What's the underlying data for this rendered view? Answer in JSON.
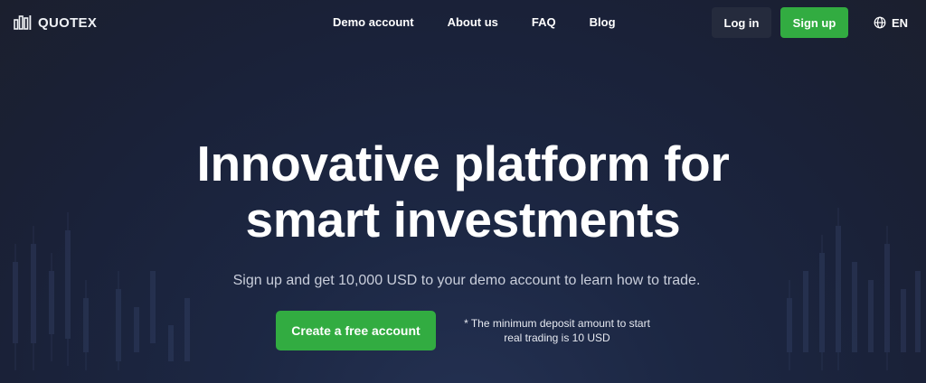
{
  "brand": {
    "name": "QUOTEX",
    "logo_icon": "quotex-bars-logo"
  },
  "nav": {
    "items": [
      {
        "label": "Demo account"
      },
      {
        "label": "About us"
      },
      {
        "label": "FAQ"
      },
      {
        "label": "Blog"
      }
    ]
  },
  "auth": {
    "login_label": "Log in",
    "signup_label": "Sign up"
  },
  "language": {
    "icon": "globe-icon",
    "label": "EN"
  },
  "hero": {
    "title_line1": "Innovative platform for",
    "title_line2": "smart investments",
    "subtitle": "Sign up and get 10,000 USD to your demo account to learn how to trade.",
    "cta_label": "Create a free account",
    "note_line1": "* The minimum deposit amount to start",
    "note_line2": "real trading is 10 USD"
  },
  "colors": {
    "accent_green": "#32ac41",
    "login_bg": "#252b3d",
    "background": "#1c2743"
  }
}
